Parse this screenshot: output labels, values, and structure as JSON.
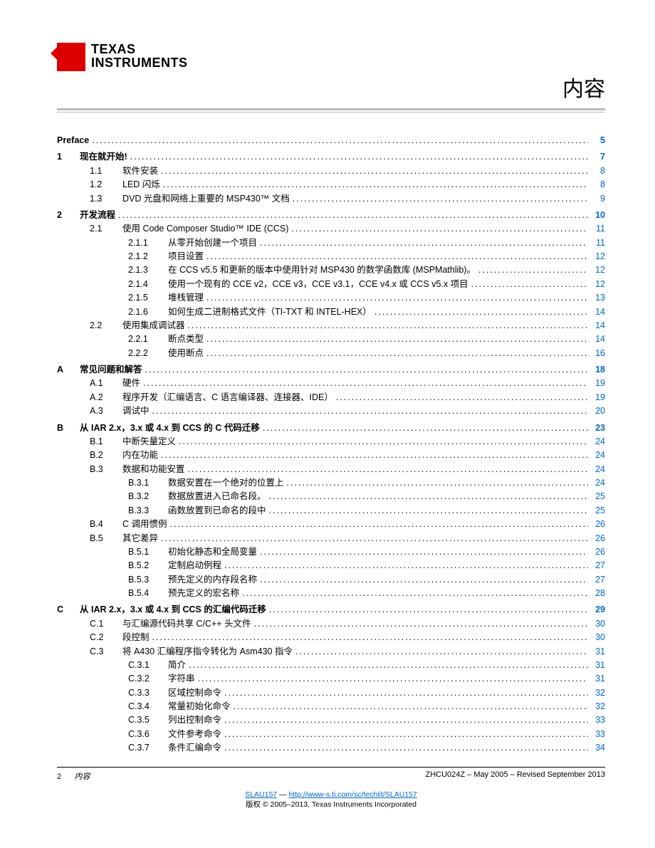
{
  "logo": {
    "line1": "TEXAS",
    "line2": "INSTRUMENTS"
  },
  "title": "内容",
  "toc": [
    {
      "lvl": 0,
      "num": "",
      "label": "Preface",
      "page": "5",
      "bold": true,
      "numcol": false
    },
    {
      "lvl": 0,
      "num": "1",
      "label": "现在就开始!",
      "page": "7",
      "bold": true
    },
    {
      "lvl": 1,
      "num": "1.1",
      "label": "软件安装",
      "page": "8"
    },
    {
      "lvl": 1,
      "num": "1.2",
      "label": "LED 闪烁",
      "page": "8"
    },
    {
      "lvl": 1,
      "num": "1.3",
      "label": "DVD 光盘和网络上重要的 MSP430™ 文档",
      "page": "9"
    },
    {
      "lvl": 0,
      "num": "2",
      "label": "开发流程",
      "page": "10",
      "bold": true
    },
    {
      "lvl": 1,
      "num": "2.1",
      "label": "使用 Code Composer Studio™ IDE (CCS)",
      "page": "11"
    },
    {
      "lvl": 2,
      "num": "2.1.1",
      "label": "从零开始创建一个项目",
      "page": "11"
    },
    {
      "lvl": 2,
      "num": "2.1.2",
      "label": "项目设置",
      "page": "12"
    },
    {
      "lvl": 2,
      "num": "2.1.3",
      "label": "在 CCS v5.5 和更新的版本中使用针对 MSP430 的数学函数库 (MSPMathlib)。",
      "page": "12"
    },
    {
      "lvl": 2,
      "num": "2.1.4",
      "label": "使用一个现有的 CCE v2，CCE v3，CCE v3.1，CCE v4.x 或 CCS v5.x 项目",
      "page": "12"
    },
    {
      "lvl": 2,
      "num": "2.1.5",
      "label": "堆栈管理",
      "page": "13"
    },
    {
      "lvl": 2,
      "num": "2.1.6",
      "label": "如何生成二进制格式文件（TI-TXT 和 INTEL-HEX）",
      "page": "14"
    },
    {
      "lvl": 1,
      "num": "2.2",
      "label": "使用集成调试器",
      "page": "14"
    },
    {
      "lvl": 2,
      "num": "2.2.1",
      "label": "断点类型",
      "page": "14"
    },
    {
      "lvl": 2,
      "num": "2.2.2",
      "label": "使用断点",
      "page": "16"
    },
    {
      "lvl": 0,
      "num": "A",
      "label": "常见问题和解答",
      "page": "18",
      "bold": true
    },
    {
      "lvl": 1,
      "num": "A.1",
      "label": "硬件",
      "page": "19"
    },
    {
      "lvl": 1,
      "num": "A.2",
      "label": "程序开发（汇编语言、C 语言编译器、连接器、IDE）",
      "page": "19"
    },
    {
      "lvl": 1,
      "num": "A.3",
      "label": "调试中",
      "page": "20"
    },
    {
      "lvl": 0,
      "num": "B",
      "label": "从 IAR 2.x，3.x 或 4.x 到 CCS 的 C 代码迁移",
      "page": "23",
      "bold": true
    },
    {
      "lvl": 1,
      "num": "B.1",
      "label": "中断矢量定义",
      "page": "24"
    },
    {
      "lvl": 1,
      "num": "B.2",
      "label": "内在功能",
      "page": "24"
    },
    {
      "lvl": 1,
      "num": "B.3",
      "label": "数据和功能安置",
      "page": "24"
    },
    {
      "lvl": 2,
      "num": "B.3.1",
      "label": "数据安置在一个绝对的位置上",
      "page": "24"
    },
    {
      "lvl": 2,
      "num": "B.3.2",
      "label": "数据放置进入已命名段。",
      "page": "25"
    },
    {
      "lvl": 2,
      "num": "B.3.3",
      "label": "函数放置到已命名的段中",
      "page": "25"
    },
    {
      "lvl": 1,
      "num": "B.4",
      "label": "C 调用惯例",
      "page": "26"
    },
    {
      "lvl": 1,
      "num": "B.5",
      "label": "其它差异",
      "page": "26"
    },
    {
      "lvl": 2,
      "num": "B.5.1",
      "label": "初始化静态和全局变量",
      "page": "26"
    },
    {
      "lvl": 2,
      "num": "B.5.2",
      "label": "定制启动例程",
      "page": "27"
    },
    {
      "lvl": 2,
      "num": "B.5.3",
      "label": "预先定义的内存段名称",
      "page": "27"
    },
    {
      "lvl": 2,
      "num": "B.5.4",
      "label": "预先定义的宏名称",
      "page": "28"
    },
    {
      "lvl": 0,
      "num": "C",
      "label": "从 IAR 2.x，3.x 或 4.x 到 CCS 的汇编代码迁移",
      "page": "29",
      "bold": true
    },
    {
      "lvl": 1,
      "num": "C.1",
      "label": "与汇编源代码共享 C/C++ 头文件",
      "page": "30"
    },
    {
      "lvl": 1,
      "num": "C.2",
      "label": "段控制",
      "page": "30"
    },
    {
      "lvl": 1,
      "num": "C.3",
      "label": "将 A430 汇编程序指令转化为 Asm430 指令",
      "page": "31"
    },
    {
      "lvl": 2,
      "num": "C.3.1",
      "label": "简介",
      "page": "31"
    },
    {
      "lvl": 2,
      "num": "C.3.2",
      "label": "字符串",
      "page": "31"
    },
    {
      "lvl": 2,
      "num": "C.3.3",
      "label": "区域控制命令",
      "page": "32"
    },
    {
      "lvl": 2,
      "num": "C.3.4",
      "label": "常量初始化命令",
      "page": "32"
    },
    {
      "lvl": 2,
      "num": "C.3.5",
      "label": "列出控制命令",
      "page": "33"
    },
    {
      "lvl": 2,
      "num": "C.3.6",
      "label": "文件参考命令",
      "page": "33"
    },
    {
      "lvl": 2,
      "num": "C.3.7",
      "label": "条件汇编命令",
      "page": "34"
    }
  ],
  "footer": {
    "pagenum": "2",
    "section": "内容",
    "docid": "ZHCU024Z – May 2005 – Revised September 2013",
    "link_label": "SLAU157",
    "link_sep": " — ",
    "link_url": "http://www-s.ti.com/sc/techlit/SLAU157",
    "copyright": "版权 © 2005–2013, Texas Instruments Incorporated"
  }
}
